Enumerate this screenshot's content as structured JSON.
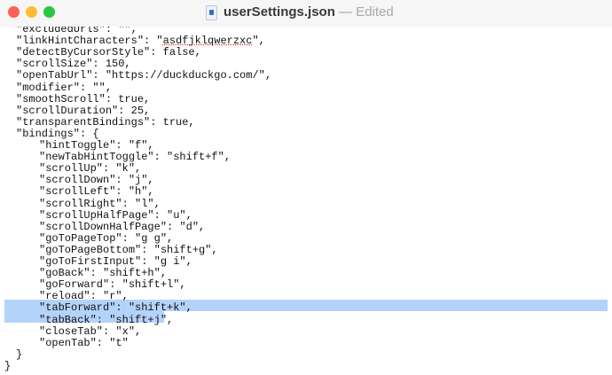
{
  "window": {
    "filename": "userSettings.json",
    "separator": " — ",
    "status": "Edited"
  },
  "colors": {
    "selection": "#b4d3fb"
  },
  "lines": [
    {
      "indent": 1,
      "text": "\"excludedUrls\": \"\","
    },
    {
      "indent": 1,
      "pre": "\"linkHintCharacters\": \"",
      "spell": "asdfjklqwerzxc",
      "post": "\","
    },
    {
      "indent": 1,
      "text": "\"detectByCursorStyle\": false,"
    },
    {
      "indent": 1,
      "text": "\"scrollSize\": 150,"
    },
    {
      "indent": 1,
      "text": "\"openTabUrl\": \"https://duckduckgo.com/\","
    },
    {
      "indent": 1,
      "text": "\"modifier\": \"\","
    },
    {
      "indent": 1,
      "text": "\"smoothScroll\": true,"
    },
    {
      "indent": 1,
      "text": "\"scrollDuration\": 25,"
    },
    {
      "indent": 1,
      "text": "\"transparentBindings\": true,"
    },
    {
      "indent": 1,
      "text": "\"bindings\": {"
    },
    {
      "indent": 2,
      "text": "\"hintToggle\": \"f\","
    },
    {
      "indent": 2,
      "text": "\"newTabHintToggle\": \"shift+f\","
    },
    {
      "indent": 2,
      "text": "\"scrollUp\": \"k\","
    },
    {
      "indent": 2,
      "text": "\"scrollDown\": \"j\","
    },
    {
      "indent": 2,
      "text": "\"scrollLeft\": \"h\","
    },
    {
      "indent": 2,
      "text": "\"scrollRight\": \"l\","
    },
    {
      "indent": 2,
      "text": "\"scrollUpHalfPage\": \"u\","
    },
    {
      "indent": 2,
      "text": "\"scrollDownHalfPage\": \"d\","
    },
    {
      "indent": 2,
      "text": "\"goToPageTop\": \"g g\","
    },
    {
      "indent": 2,
      "text": "\"goToPageBottom\": \"shift+g\","
    },
    {
      "indent": 2,
      "text": "\"goToFirstInput\": \"g i\","
    },
    {
      "indent": 2,
      "text": "\"goBack\": \"shift+h\","
    },
    {
      "indent": 2,
      "text": "\"goForward\": \"shift+l\","
    },
    {
      "indent": 2,
      "text": "\"reload\": \"r\","
    },
    {
      "indent": 2,
      "text": "\"tabForward\": \"shift+k\",",
      "selected": "full"
    },
    {
      "indent": 2,
      "text": "\"tabBack\": \"shift+j\",",
      "selected": "partial"
    },
    {
      "indent": 2,
      "text": "\"closeTab\": \"x\","
    },
    {
      "indent": 2,
      "text": "\"openTab\": \"t\""
    },
    {
      "indent": 1,
      "text": "}"
    },
    {
      "indent": 0,
      "text": "}"
    }
  ]
}
